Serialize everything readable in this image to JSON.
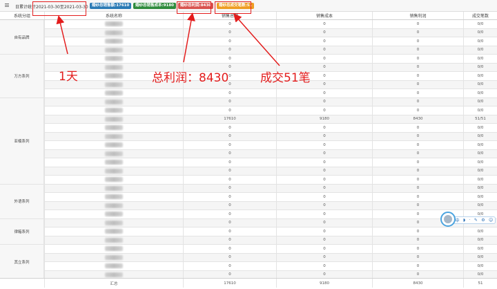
{
  "topbar": {
    "period_label": "日累计统计2021-03-30至2021-03-30",
    "badges": {
      "sales_total": "婚纱总销售额:17610",
      "sales_cost": "婚纱总销售成本:9180",
      "sales_profit": "婚纱总利润:8430",
      "deal_count": "婚纱总成交笔数:51"
    }
  },
  "table": {
    "columns": [
      "系统分组",
      "系统名称",
      "销售总额",
      "销售成本",
      "销售利润",
      "成交笔数"
    ],
    "groups": [
      {
        "name": "自有品牌",
        "rows": 4
      },
      {
        "name": "万方系列",
        "rows": 5
      },
      {
        "name": "亚楠系列",
        "rows": 10
      },
      {
        "name": "外语系列",
        "rows": 4
      },
      {
        "name": "律箱系列",
        "rows": 3
      },
      {
        "name": "其立系列",
        "rows": 4
      }
    ],
    "rows": [
      {
        "sales": "0",
        "cost": "0",
        "profit": "0",
        "deals": "0/0"
      },
      {
        "sales": "0",
        "cost": "0",
        "profit": "0",
        "deals": "0/0"
      },
      {
        "sales": "0",
        "cost": "0",
        "profit": "0",
        "deals": "0/0"
      },
      {
        "sales": "0",
        "cost": "0",
        "profit": "0",
        "deals": "0/0"
      },
      {
        "sales": "0",
        "cost": "0",
        "profit": "0",
        "deals": "0/0"
      },
      {
        "sales": "0",
        "cost": "0",
        "profit": "0",
        "deals": "0/0"
      },
      {
        "sales": "0",
        "cost": "0",
        "profit": "0",
        "deals": "0/0"
      },
      {
        "sales": "0",
        "cost": "0",
        "profit": "0",
        "deals": "0/0"
      },
      {
        "sales": "0",
        "cost": "0",
        "profit": "0",
        "deals": "0/0"
      },
      {
        "sales": "0",
        "cost": "0",
        "profit": "0",
        "deals": "0/0"
      },
      {
        "sales": "0",
        "cost": "0",
        "profit": "0",
        "deals": "0/0"
      },
      {
        "sales": "17610",
        "cost": "9180",
        "profit": "8430",
        "deals": "51/51"
      },
      {
        "sales": "0",
        "cost": "0",
        "profit": "0",
        "deals": "0/0"
      },
      {
        "sales": "0",
        "cost": "0",
        "profit": "0",
        "deals": "0/0"
      },
      {
        "sales": "0",
        "cost": "0",
        "profit": "0",
        "deals": "0/0"
      },
      {
        "sales": "0",
        "cost": "0",
        "profit": "0",
        "deals": "0/0"
      },
      {
        "sales": "0",
        "cost": "0",
        "profit": "0",
        "deals": "0/0"
      },
      {
        "sales": "0",
        "cost": "0",
        "profit": "0",
        "deals": "0/0"
      },
      {
        "sales": "0",
        "cost": "0",
        "profit": "0",
        "deals": "0/0"
      },
      {
        "sales": "0",
        "cost": "0",
        "profit": "0",
        "deals": "0/0"
      },
      {
        "sales": "0",
        "cost": "0",
        "profit": "0",
        "deals": "0/0"
      },
      {
        "sales": "0",
        "cost": "0",
        "profit": "0",
        "deals": "0/0"
      },
      {
        "sales": "0",
        "cost": "0",
        "profit": "0",
        "deals": "0/0"
      },
      {
        "sales": "0",
        "cost": "0",
        "profit": "0",
        "deals": "0/0"
      },
      {
        "sales": "0",
        "cost": "0",
        "profit": "0",
        "deals": "0/0"
      },
      {
        "sales": "0",
        "cost": "0",
        "profit": "0",
        "deals": "0/0"
      },
      {
        "sales": "0",
        "cost": "0",
        "profit": "0",
        "deals": "0/0"
      },
      {
        "sales": "0",
        "cost": "0",
        "profit": "0",
        "deals": "0/0"
      },
      {
        "sales": "0",
        "cost": "0",
        "profit": "0",
        "deals": "0/0"
      },
      {
        "sales": "0",
        "cost": "0",
        "profit": "0",
        "deals": "0/0"
      }
    ],
    "total": {
      "label": "汇总",
      "sales": "17610",
      "cost": "9180",
      "profit": "8430",
      "deals": "51"
    }
  },
  "annotations": {
    "one_day": "1天",
    "total_profit": "总利润：8430",
    "deals": "成交51笔"
  },
  "floating_toolbar": {
    "tools": [
      "中",
      "◗",
      "·",
      "✎",
      "⚙",
      "☺"
    ],
    "avatar_icon": "user-avatar-icon"
  },
  "colors": {
    "annotation": "#e31c1c",
    "badge_blue": "#2a7ab5",
    "badge_green": "#2f8b3d",
    "badge_red": "#d9534f",
    "badge_orange": "#ee9d21"
  }
}
